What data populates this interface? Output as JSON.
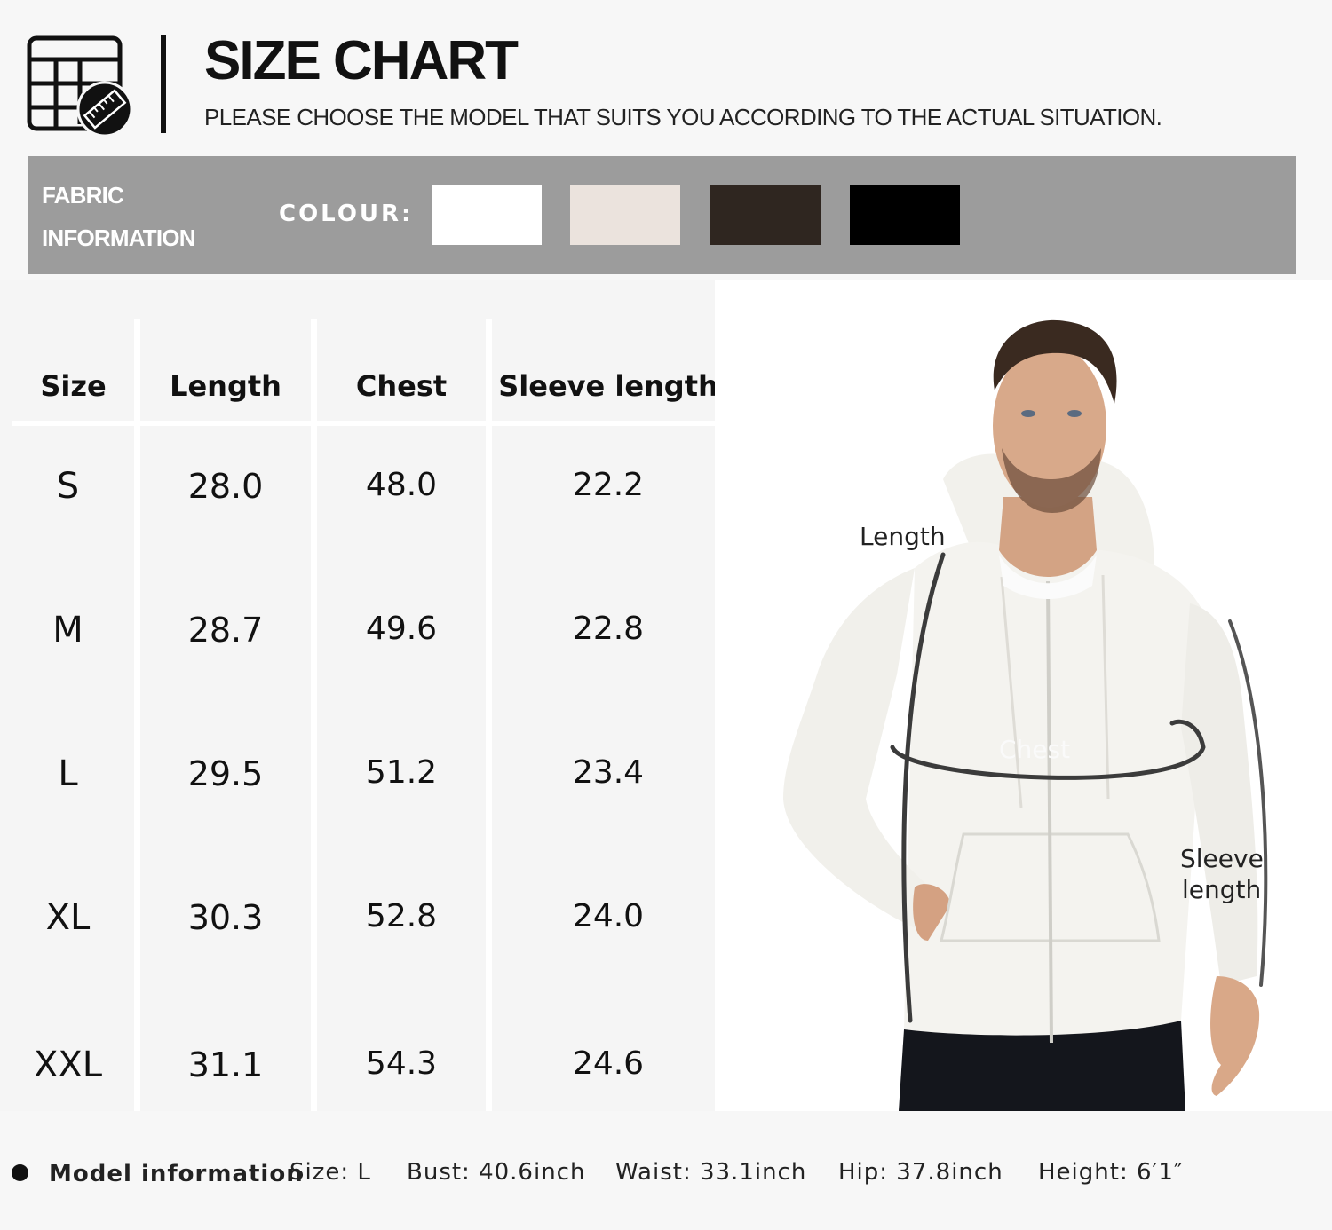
{
  "header": {
    "title": "SIZE CHART",
    "subtitle": "PLEASE CHOOSE THE MODEL THAT SUITS YOU ACCORDING TO THE ACTUAL SITUATION.",
    "icon": "size-table-ruler-icon"
  },
  "fabric": {
    "label_line1": "FABRIC",
    "label_line2": "INFORMATION",
    "colour_label": "COLOUR:",
    "swatches": [
      "#ffffff",
      "#ebe3dd",
      "#2f2620",
      "#000000"
    ]
  },
  "table": {
    "headers": [
      "Size",
      "Length",
      "Chest",
      "Sleeve length"
    ],
    "rows": [
      [
        "S",
        "28.0",
        "48.0",
        "22.2"
      ],
      [
        "M",
        "28.7",
        "49.6",
        "22.8"
      ],
      [
        "L",
        "29.5",
        "51.2",
        "23.4"
      ],
      [
        "XL",
        "30.3",
        "52.8",
        "24.0"
      ],
      [
        "XXL",
        "31.1",
        "54.3",
        "24.6"
      ]
    ]
  },
  "diagram": {
    "length": "Length",
    "chest": "Chest",
    "sleeve_line1": "Sleeve",
    "sleeve_line2": "length"
  },
  "model": {
    "label": "Model information",
    "size": "Size: L",
    "bust": "Bust: 40.6inch",
    "waist": "Waist: 33.1inch",
    "hip": "Hip: 37.8inch",
    "height": "Height: 6′1″"
  }
}
